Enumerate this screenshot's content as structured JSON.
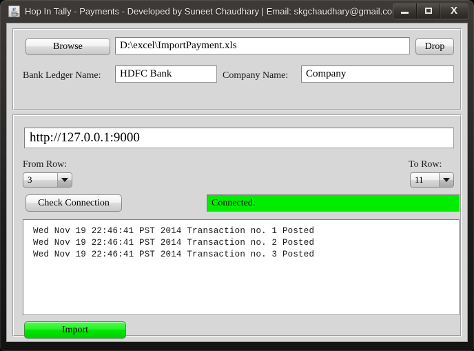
{
  "window": {
    "title": "Hop In Tally  - Payments - Developed by Suneet Chaudhary | Email: skgchaudhary@gmail.com",
    "app_icon": "java-coffee-cup-icon",
    "controls": {
      "minimize": "minimize-icon",
      "maximize": "maximize-icon",
      "close": "X"
    }
  },
  "file_panel": {
    "browse_label": "Browse",
    "file_path_value": "D:\\excel\\ImportPayment.xls",
    "file_path_placeholder": "",
    "drop_label": "Drop",
    "bank_ledger_label": "Bank Ledger Name:",
    "bank_ledger_value": "HDFC Bank",
    "bank_ledger_placeholder": "",
    "company_label": "Company Name:",
    "company_value": "Company",
    "company_placeholder": ""
  },
  "connection_panel": {
    "url_value": "http://127.0.0.1:9000",
    "url_placeholder": "",
    "from_row_label": "From Row:",
    "from_row_value": "3",
    "to_row_label": "To Row:",
    "to_row_value": "11",
    "check_connection_label": "Check Connection",
    "status_text": "Connected.",
    "status_color": "#00ed00",
    "import_label": "Import",
    "import_color": "#00e600",
    "log_lines": [
      "Wed Nov 19 22:46:41 PST 2014 Transaction no. 1 Posted",
      "Wed Nov 19 22:46:41 PST 2014 Transaction no. 2 Posted",
      "Wed Nov 19 22:46:41 PST 2014 Transaction no. 3 Posted"
    ]
  }
}
